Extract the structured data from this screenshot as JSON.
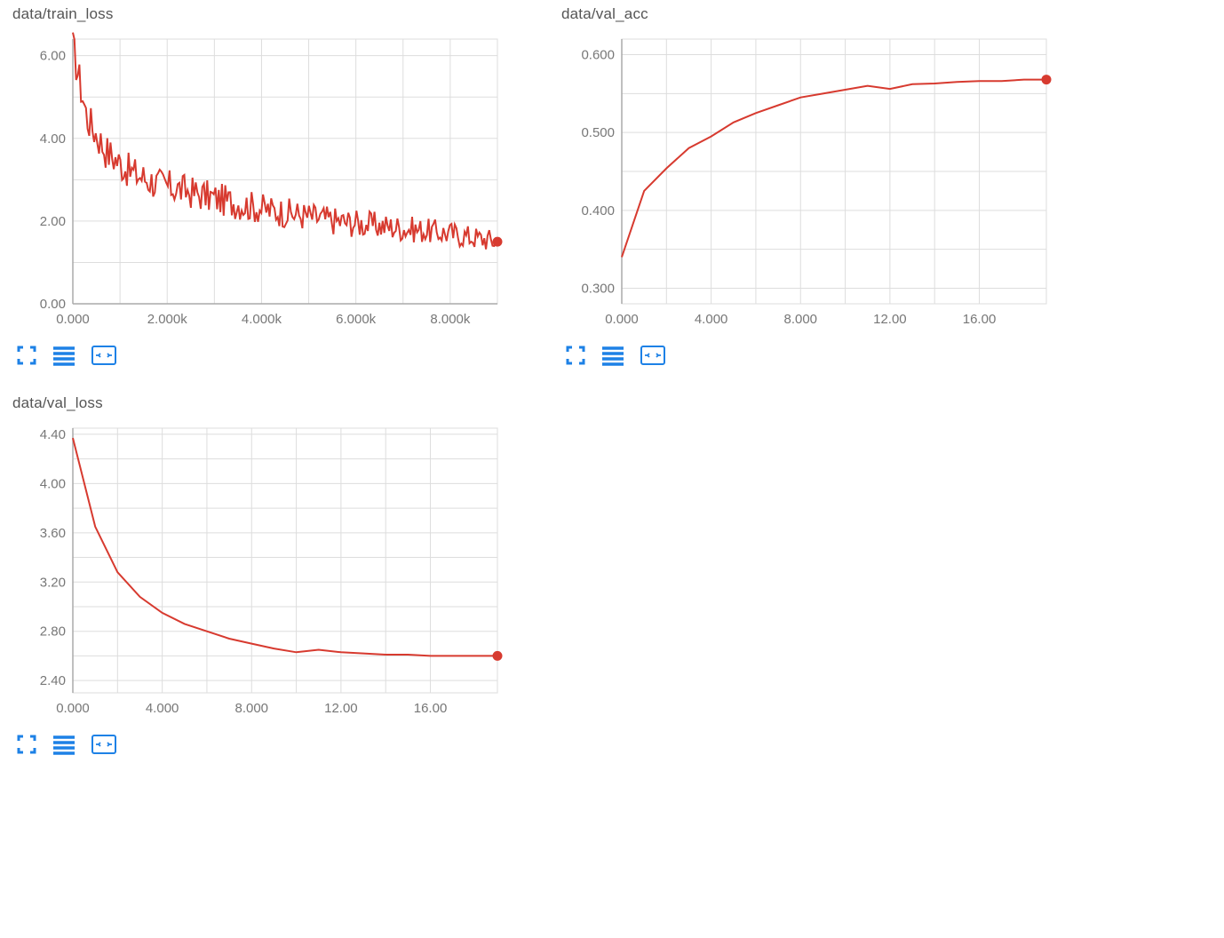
{
  "panels": [
    {
      "title": "data/train_loss"
    },
    {
      "title": "data/val_acc"
    },
    {
      "title": "data/val_loss"
    }
  ],
  "chart_data": [
    {
      "type": "line",
      "title": "data/train_loss",
      "xlabel": "",
      "ylabel": "",
      "xlim": [
        0,
        9000
      ],
      "ylim": [
        0,
        6.4
      ],
      "xticks": [
        0,
        2000,
        4000,
        6000,
        8000
      ],
      "xtick_labels": [
        "0.000",
        "2.000k",
        "4.000k",
        "6.000k",
        "8.000k"
      ],
      "yticks": [
        0.0,
        2.0,
        4.0,
        6.0
      ],
      "ytick_labels": [
        "0.00",
        "2.00",
        "4.00",
        "6.00"
      ],
      "noisy": true,
      "series": [
        {
          "name": "train_loss",
          "color": "#d73a2f",
          "x": [
            0,
            300,
            700,
            1200,
            1800,
            2500,
            3200,
            4000,
            4800,
            5600,
            6400,
            7200,
            8000,
            8800,
            9000
          ],
          "y": [
            6.2,
            4.5,
            3.7,
            3.2,
            2.9,
            2.7,
            2.5,
            2.3,
            2.15,
            2.0,
            1.9,
            1.8,
            1.7,
            1.55,
            1.5
          ]
        }
      ],
      "end_marker": {
        "x": 9000,
        "y": 1.5
      }
    },
    {
      "type": "line",
      "title": "data/val_acc",
      "xlabel": "",
      "ylabel": "",
      "xlim": [
        0,
        19
      ],
      "ylim": [
        0.28,
        0.62
      ],
      "xticks": [
        0,
        4,
        8,
        12,
        16
      ],
      "xtick_labels": [
        "0.000",
        "4.000",
        "8.000",
        "12.00",
        "16.00"
      ],
      "yticks": [
        0.3,
        0.4,
        0.5,
        0.6
      ],
      "ytick_labels": [
        "0.300",
        "0.400",
        "0.500",
        "0.600"
      ],
      "noisy": false,
      "series": [
        {
          "name": "val_acc",
          "color": "#d73a2f",
          "x": [
            0,
            1,
            2,
            3,
            4,
            5,
            6,
            7,
            8,
            9,
            10,
            11,
            12,
            13,
            14,
            15,
            16,
            17,
            18,
            19
          ],
          "y": [
            0.34,
            0.425,
            0.454,
            0.48,
            0.495,
            0.513,
            0.525,
            0.535,
            0.545,
            0.55,
            0.555,
            0.56,
            0.556,
            0.562,
            0.563,
            0.565,
            0.566,
            0.566,
            0.568,
            0.568
          ]
        }
      ],
      "end_marker": {
        "x": 19,
        "y": 0.568
      }
    },
    {
      "type": "line",
      "title": "data/val_loss",
      "xlabel": "",
      "ylabel": "",
      "xlim": [
        0,
        19
      ],
      "ylim": [
        2.3,
        4.45
      ],
      "xticks": [
        0,
        4,
        8,
        12,
        16
      ],
      "xtick_labels": [
        "0.000",
        "4.000",
        "8.000",
        "12.00",
        "16.00"
      ],
      "yticks": [
        2.4,
        2.8,
        3.2,
        3.6,
        4.0,
        4.4
      ],
      "ytick_labels": [
        "2.40",
        "2.80",
        "3.20",
        "3.60",
        "4.00",
        "4.40"
      ],
      "noisy": false,
      "series": [
        {
          "name": "val_loss",
          "color": "#d73a2f",
          "x": [
            0,
            1,
            2,
            3,
            4,
            5,
            6,
            7,
            8,
            9,
            10,
            11,
            12,
            13,
            14,
            15,
            16,
            17,
            18,
            19
          ],
          "y": [
            4.37,
            3.65,
            3.28,
            3.08,
            2.95,
            2.86,
            2.8,
            2.74,
            2.7,
            2.66,
            2.63,
            2.65,
            2.63,
            2.62,
            2.61,
            2.61,
            2.6,
            2.6,
            2.6,
            2.6
          ]
        }
      ],
      "end_marker": {
        "x": 19,
        "y": 2.6
      }
    }
  ],
  "icons": {
    "expand": "expand-icon",
    "lines": "lines-icon",
    "fit": "fit-icon"
  }
}
